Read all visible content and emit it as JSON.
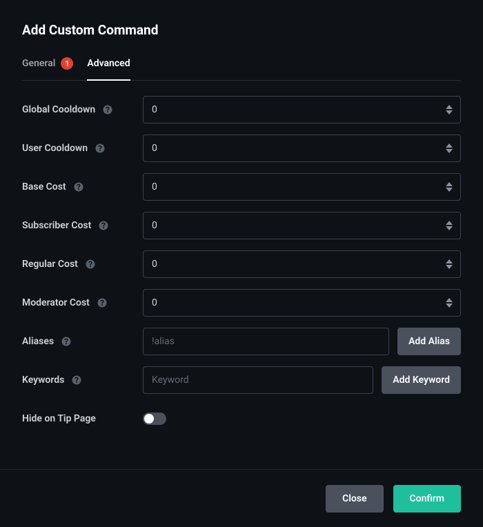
{
  "title": "Add Custom Command",
  "tabs": {
    "general": {
      "label": "General",
      "badge": "1"
    },
    "advanced": {
      "label": "Advanced"
    }
  },
  "fields": {
    "global_cooldown": {
      "label": "Global Cooldown",
      "value": "0"
    },
    "user_cooldown": {
      "label": "User Cooldown",
      "value": "0"
    },
    "base_cost": {
      "label": "Base Cost",
      "value": "0"
    },
    "subscriber_cost": {
      "label": "Subscriber Cost",
      "value": "0"
    },
    "regular_cost": {
      "label": "Regular Cost",
      "value": "0"
    },
    "moderator_cost": {
      "label": "Moderator Cost",
      "value": "0"
    },
    "aliases": {
      "label": "Aliases",
      "placeholder": "!alias",
      "button": "Add Alias"
    },
    "keywords": {
      "label": "Keywords",
      "placeholder": "Keyword",
      "button": "Add Keyword"
    },
    "hide_on_tip": {
      "label": "Hide on Tip Page",
      "value": false
    }
  },
  "footer": {
    "close": "Close",
    "confirm": "Confirm"
  }
}
